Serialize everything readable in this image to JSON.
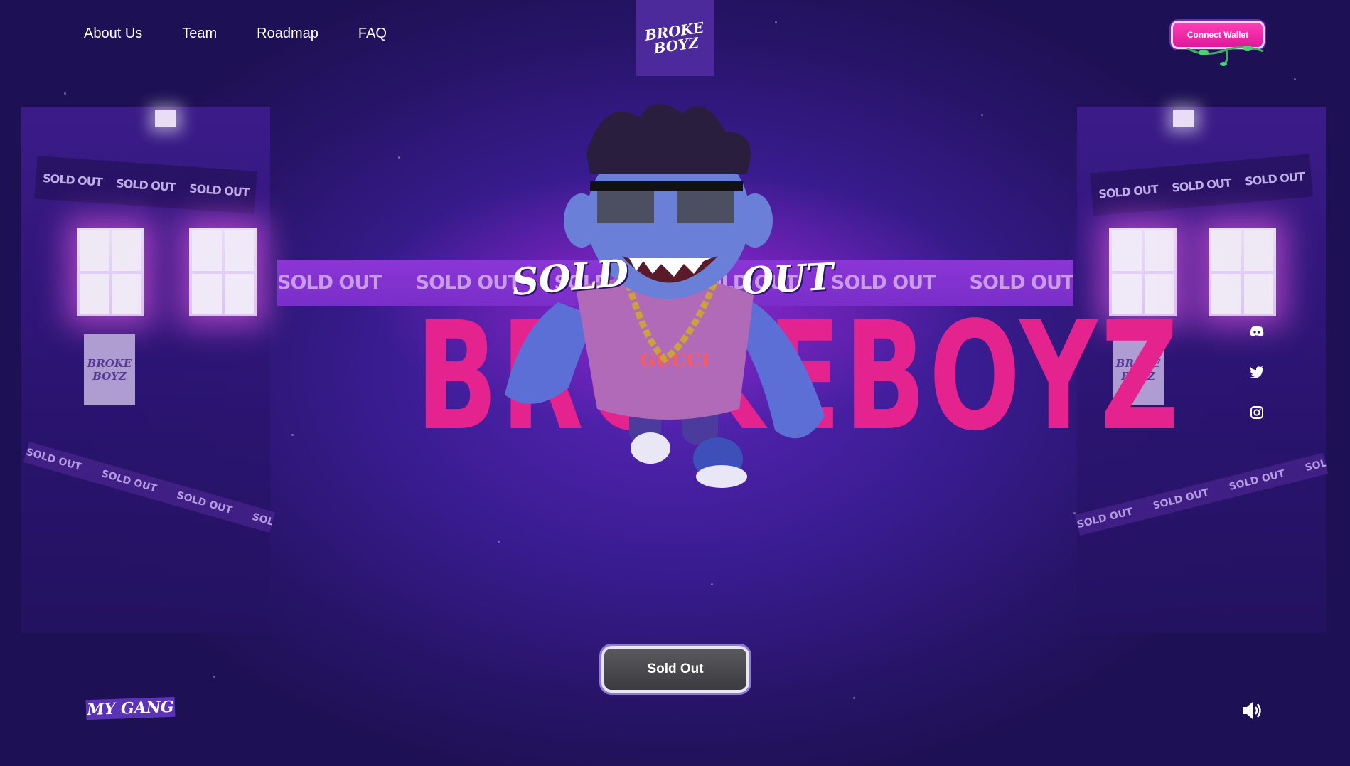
{
  "nav": {
    "links": [
      "About Us",
      "Team",
      "Roadmap",
      "FAQ"
    ]
  },
  "brand": {
    "logo_line1": "BROKE",
    "logo_line2": "BOYZ",
    "hero_text": "BROKEBOYZ"
  },
  "header": {
    "wallet_label": "Connect Wallet"
  },
  "hero": {
    "sold_word": "SOLD",
    "out_word": "OUT",
    "tape_text": "SOLD OUT",
    "booth_poster": "BROKE BOYZ"
  },
  "social": {
    "icons": [
      "discord-icon",
      "twitter-icon",
      "instagram-icon"
    ]
  },
  "cta": {
    "sold_out_label": "Sold Out"
  },
  "footer": {
    "gang_label": "MY GANG"
  },
  "colors": {
    "accent_pink": "#e4238f",
    "wallet_pink": "#ff3fb6",
    "background": "#2a1670"
  }
}
